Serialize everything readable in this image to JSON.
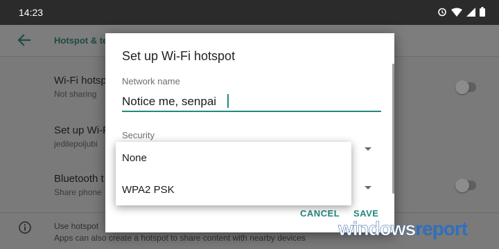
{
  "status_bar": {
    "time": "14:23",
    "icons": [
      "alarm-icon",
      "wifi-icon",
      "signal-icon",
      "battery-icon"
    ]
  },
  "app_bar": {
    "title": "Hotspot & te",
    "back_icon": "back-arrow-icon"
  },
  "settings": [
    {
      "title": "Wi-Fi hotsp",
      "subtitle": "Not sharing",
      "toggle_on": false
    },
    {
      "title": "Set up Wi-F",
      "subtitle": "jedilepoljubi"
    },
    {
      "title": "Bluetooth t",
      "subtitle": "Share phone",
      "toggle_on": false
    }
  ],
  "footer": {
    "line1": "Use hotspot",
    "line2": "Apps can also create a hotspot to share content with nearby devices"
  },
  "dialog": {
    "title": "Set up Wi-Fi hotspot",
    "network_label": "Network name",
    "network_value": "Notice me, senpai",
    "security_label": "Security",
    "cancel_label": "CANCEL",
    "save_label": "SAVE"
  },
  "security_menu": {
    "options": [
      "None",
      "WPA2 PSK"
    ]
  },
  "watermark": {
    "part1": "windows",
    "part2": "report"
  },
  "colors": {
    "accent": "#22897c",
    "status_bar": "#2b2b2b",
    "scrim": "#7a7a7a"
  }
}
